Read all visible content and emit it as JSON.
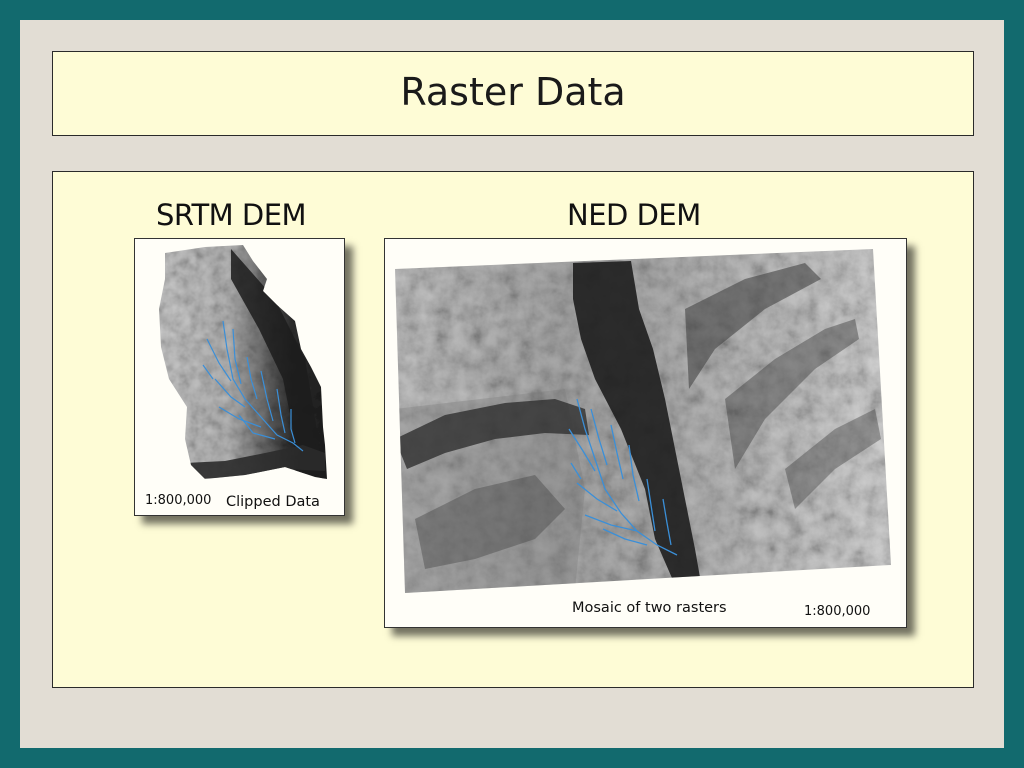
{
  "title": "Raster Data",
  "srtm": {
    "heading": "SRTM DEM",
    "scale": "1:800,000",
    "caption": "Clipped Data"
  },
  "ned": {
    "heading": "NED DEM",
    "caption": "Mosaic of two rasters",
    "scale": "1:800,000"
  },
  "colors": {
    "outer_border": "#126a6e",
    "slide_background": "#e2ddd4",
    "panel_background": "#fefcd6",
    "stream_network": "#3a8fd8"
  }
}
